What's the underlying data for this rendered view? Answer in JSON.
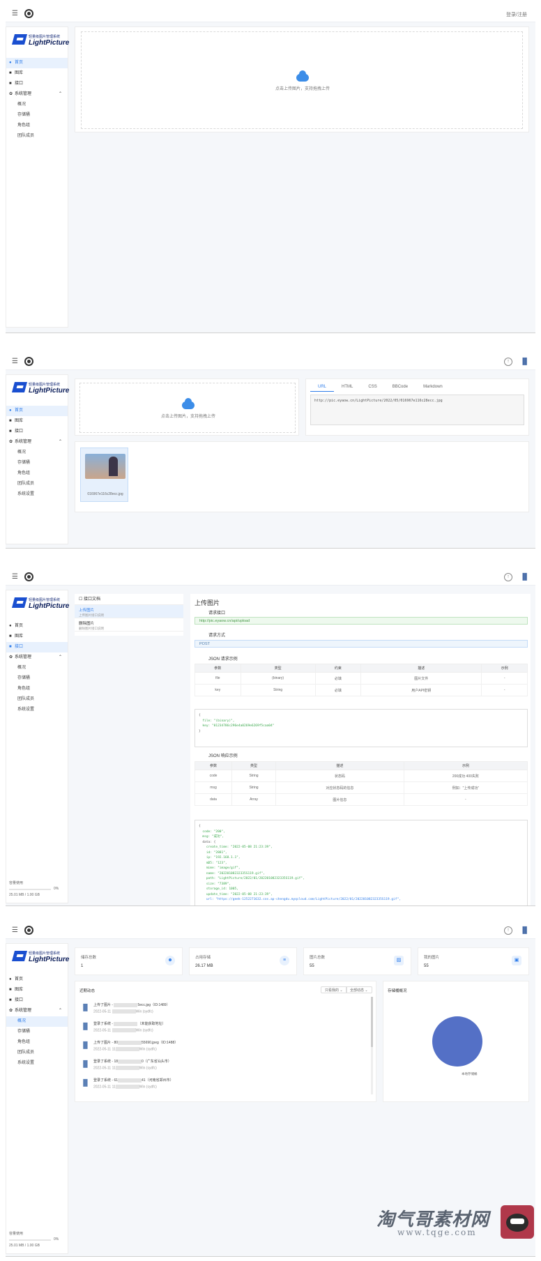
{
  "brand": {
    "cn": "轻量级图片管理系统",
    "en": "LightPicture"
  },
  "topbar": {
    "login": "登录/注册"
  },
  "menu": {
    "home": "首页",
    "images": "图库",
    "api": "接口",
    "system": "系统管理"
  },
  "submenu": {
    "overview": "概况",
    "storage": "存储桶",
    "roles": "角色组",
    "team": "团队成员",
    "settings": "系统设置"
  },
  "upload": {
    "hint": "点击上传图片，支持拖拽上传"
  },
  "linktabs": [
    "URL",
    "HTML",
    "CSS",
    "BBCode",
    "Markdown"
  ],
  "link_url": "http://pic.eyaow.cn/LightPicture/2022/05/016967e116c28ecc.jpg",
  "thumb_name": "016967e116c28ecc.jpg",
  "docs": {
    "list_title": "接口文档",
    "items": [
      {
        "title": "上传图片",
        "desc": "上传图片接口说明"
      },
      {
        "title": "删除图片",
        "desc": "删除图片接口说明"
      }
    ],
    "title": "上传图片",
    "req_url_label": "请求接口",
    "req_url": "http://pic.eyaow.cn/api/upload",
    "method_label": "请求方式",
    "method": "POST",
    "req_example_label": "JSON 请求示例",
    "req_headers": [
      "参数",
      "类型",
      "约束",
      "描述",
      "示例"
    ],
    "req_rows": [
      [
        "file",
        "(binary)",
        "必填",
        "图片文件",
        "-"
      ],
      [
        "key",
        "String",
        "必填",
        "用户API密钥",
        "-"
      ]
    ],
    "req_code": [
      "{",
      "  file: \"(binary)\",",
      "  key: \"01234786c296e4a0269e6269f5caa04\"",
      "}"
    ],
    "resp_example_label": "JSON 响应示例",
    "resp_headers": [
      "参数",
      "类型",
      "描述",
      "示例"
    ],
    "resp_rows": [
      [
        "code",
        "String",
        "状态码",
        "200成功 400失败"
      ],
      [
        "msg",
        "String",
        "对应状态码的信息",
        "例如：\"上传成功\""
      ],
      [
        "data",
        "Array",
        "图片信息",
        "-"
      ]
    ],
    "resp_code": [
      "{",
      "  code: \"200\",",
      "  msg: \"成功\",",
      "  data: {",
      "    create_time: \"2022-05-08 21:23:39\",",
      "    id: \"2881\",",
      "    ip: \"192.168.1.1\",",
      "    mD5: \"123\",",
      "    mime: \"image/gif\",",
      "    name: \"20220108232335S119.gif\",",
      "    path: \"LightPicture/2022/01/20220108232335S119.gif\",",
      "    size: \"7389\",",
      "    storage_id: 1005,",
      "    update_time: \"2022-05-08 21:23:39\",",
      "    url: \"https://geek-1252271632.cos.ap-chengdu.myqcloud.com/LightPicture/2022/01/20220108232335S119.gif\","
    ]
  },
  "storage_usage": {
    "label": "容量使用",
    "pct": "0%",
    "used": "25.01 MB / 1.00 GB",
    "fraction": 0.02
  },
  "dashboard": {
    "stats": [
      {
        "label": "储存总数",
        "value": "1"
      },
      {
        "label": "占用存储",
        "value": "26.17 MB"
      },
      {
        "label": "图片总数",
        "value": "55"
      },
      {
        "label": "我的图片",
        "value": "55"
      }
    ],
    "activity_title": "近期动态",
    "filter1": "只看我的",
    "filter2": "全部动态",
    "chart_title": "存储桶概况",
    "activities": [
      {
        "line1a": "上传了图片 - ",
        "line1b": "5ecc.jpg（ID:1489）",
        "line2a": "2022-05-11 ",
        "line2b": "Win (sydfc)"
      },
      {
        "line1a": "登录了系统 - ",
        "line1b": "（未能获取地址）",
        "line2a": "2022-05-11 ",
        "line2b": "Win (sydfc)"
      },
      {
        "line1a": "上传了图片 - 80",
        "line1b": "55690.jpeg（ID:1488）",
        "line2a": "2022-05-11 11",
        "line2b": "Win (sydfc)"
      },
      {
        "line1a": "登录了系统 - 18",
        "line1b": "0（广东省汕头市）",
        "line2a": "2022-05-11 11",
        "line2b": "Win (sydfc)"
      },
      {
        "line1a": "登录了系统 - 61",
        "line1b": "41（河南省郑州市）",
        "line2a": "2022-05-11 11",
        "line2b": "Win (sydfc)"
      }
    ],
    "pie_label": "本地存储桶"
  },
  "chart_data": {
    "type": "pie",
    "title": "存储桶概况",
    "categories": [
      "本地存储桶"
    ],
    "values": [
      1
    ]
  },
  "watermark": {
    "cn": "淘气哥素材网",
    "url": "www.tqge.com"
  },
  "colors": {
    "accent": "#2f7dea",
    "pie": "#5470c6"
  }
}
